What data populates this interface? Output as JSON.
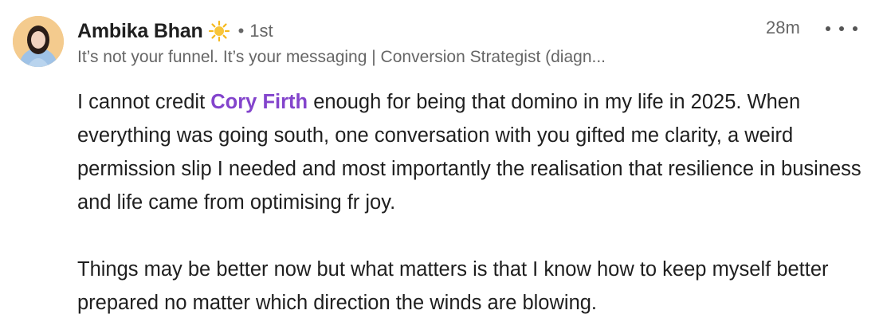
{
  "comment": {
    "author": {
      "name": "Ambika Bhan",
      "badge_icon": "sun-icon",
      "degree_separator": "•",
      "degree": "1st",
      "headline": "It’s not your funnel. It’s your messaging | Conversion Strategist (diagn..."
    },
    "timestamp": "28m",
    "more_icon": "ellipsis-icon",
    "body": {
      "p1_before_mention": "I cannot credit ",
      "mention": "Cory Firth",
      "p1_after_mention": " enough for being that domino in my life in 2025. When everything was going south, one conversation with you gifted me clarity, a weird permission slip I needed and most importantly the realisation that resilience in business and life came from optimising fr joy.",
      "p2": "Things may be better now but what matters is that I know how to keep myself better prepared no matter which direction the winds are blowing."
    }
  },
  "colors": {
    "mention": "#8344cc",
    "text": "#1f1f1f",
    "muted": "#666666"
  }
}
